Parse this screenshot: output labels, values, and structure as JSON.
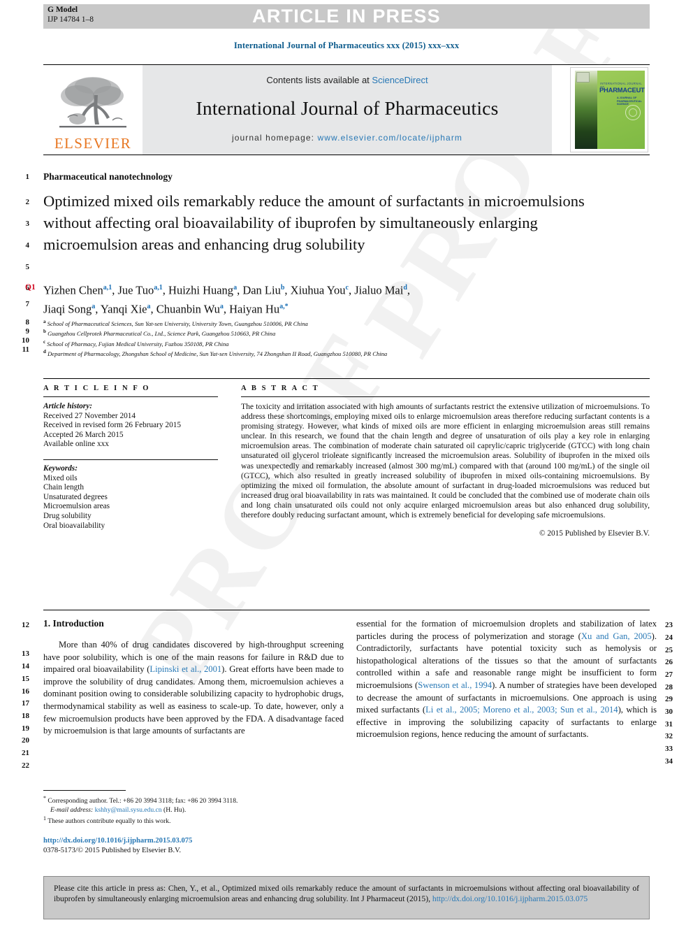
{
  "header": {
    "g_model_line1": "G Model",
    "g_model_line2": "IJP 14784 1–8",
    "article_in_press": "ARTICLE IN PRESS",
    "journal_reference": "International Journal of Pharmaceutics xxx (2015) xxx–xxx"
  },
  "masthead": {
    "contents_prefix": "Contents lists available at ",
    "sciencedirect": "ScienceDirect",
    "journal_title": "International Journal of Pharmaceutics",
    "homepage_prefix": "journal homepage: ",
    "homepage_url": "www.elsevier.com/locate/ijpharm",
    "publisher_wordmark": "ELSEVIER",
    "cover": {
      "supertitle": "INTERNATIONAL JOURNAL OF",
      "title": "PHARMACEUTICS",
      "subtitle": "A JOURNAL OF\nPHARMACEUTICAL\nSCIENCE AND PRACTICE"
    }
  },
  "article": {
    "section_label": "Pharmaceutical nanotechnology",
    "title": "Optimized mixed oils remarkably reduce the amount of surfactants in microemulsions without affecting oral bioavailability of ibuprofen by simultaneously enlarging microemulsion areas and enhancing drug solubility",
    "query_tag": "Q1",
    "authors": [
      {
        "name": "Yizhen Chen",
        "sup": "a,1"
      },
      {
        "name": "Jue Tuo",
        "sup": "a,1"
      },
      {
        "name": "Huizhi Huang",
        "sup": "a"
      },
      {
        "name": "Dan Liu",
        "sup": "b"
      },
      {
        "name": "Xiuhua You",
        "sup": "c"
      },
      {
        "name": "Jialuo Mai",
        "sup": "d"
      },
      {
        "name": "Jiaqi Song",
        "sup": "a"
      },
      {
        "name": "Yanqi Xie",
        "sup": "a"
      },
      {
        "name": "Chuanbin Wu",
        "sup": "a"
      },
      {
        "name": "Haiyan Hu",
        "sup": "a,*"
      }
    ],
    "affiliations": [
      {
        "label": "a",
        "text": "School of Pharmaceutical Sciences, Sun Yat-sen University, University Town, Guangzhou 510006, PR China"
      },
      {
        "label": "b",
        "text": "Guangzhou Cellprotek Pharmaceutical Co., Ltd., Science Park, Guangzhou 510663, PR China"
      },
      {
        "label": "c",
        "text": "School of Pharmacy, Fujian Medical University, Fuzhou 350108, PR China"
      },
      {
        "label": "d",
        "text": "Department of Pharmacology, Zhongshan School of Medicine, Sun Yat-sen University, 74 Zhongshan II Road, Guangzhou 510080, PR China"
      }
    ]
  },
  "article_info": {
    "heading": "A R T I C L E   I N F O",
    "history_label": "Article history:",
    "history": [
      "Received 27 November 2014",
      "Received in revised form 26 February 2015",
      "Accepted 26 March 2015",
      "Available online xxx"
    ],
    "keywords_label": "Keywords:",
    "keywords": [
      "Mixed oils",
      "Chain length",
      "Unsaturated degrees",
      "Microemulsion areas",
      "Drug solubility",
      "Oral bioavailability"
    ]
  },
  "abstract": {
    "heading": "A B S T R A C T",
    "text": "The toxicity and irritation associated with high amounts of surfactants restrict the extensive utilization of microemulsions. To address these shortcomings, employing mixed oils to enlarge microemulsion areas therefore reducing surfactant contents is a promising strategy. However, what kinds of mixed oils are more efficient in enlarging microemulsion areas still remains unclear. In this research, we found that the chain length and degree of unsaturation of oils play a key role in enlarging microemulsion areas. The combination of moderate chain saturated oil caprylic/capric triglyceride (GTCC) with long chain unsaturated oil glycerol trioleate significantly increased the microemulsion areas. Solubility of ibuprofen in the mixed oils was unexpectedly and remarkably increased (almost 300 mg/mL) compared with that (around 100 mg/mL) of the single oil (GTCC), which also resulted in greatly increased solubility of ibuprofen in mixed oils-containing microemulsions. By optimizing the mixed oil formulation, the absolute amount of surfactant in drug-loaded microemulsions was reduced but increased drug oral bioavailability in rats was maintained. It could be concluded that the combined use of moderate chain oils and long chain unsaturated oils could not only acquire enlarged microemulsion areas but also enhanced drug solubility, therefore doubly reducing surfactant amount, which is extremely beneficial for developing safe microemulsions.",
    "copyright": "© 2015 Published by Elsevier B.V."
  },
  "introduction": {
    "heading": "1. Introduction",
    "left_paragraph_part1": "More than 40% of drug candidates discovered by high-throughput screening have poor solubility, which is one of the main reasons for failure in R&D due to impaired oral bioavailability (",
    "left_ref1": "Lipinski et al., 2001",
    "left_paragraph_part2": "). Great efforts have been made to improve the solubility of drug candidates. Among them, microemulsion achieves a dominant position owing to considerable solubilizing capacity to hydrophobic drugs, thermodynamical stability as well as easiness to scale-up. To date, however, only a few microemulsion products have been approved by the FDA. A disadvantage faced by microemulsion is that large amounts of surfactants are",
    "right_part1": "essential for the formation of microemulsion droplets and stabilization of latex particles during the process of polymerization and storage (",
    "right_ref1": "Xu and Gan, 2005",
    "right_part2": "). Contradictorily, surfactants have potential toxicity such as hemolysis or histopathological alterations of the tissues so that the amount of surfactants controlled within a safe and reasonable range might be insufficient to form microemulsions (",
    "right_ref2": "Swenson et al., 1994",
    "right_part3": "). A number of strategies have been developed to decrease the amount of surfactants in microemulsions. One approach is using mixed surfactants (",
    "right_ref3": "Li et al., 2005; Moreno et al., 2003; Sun et al., 2014",
    "right_part4": "), which is effective in improving the solubilizing capacity of surfactants to enlarge microemulsion regions, hence reducing the amount of surfactants."
  },
  "footnotes": {
    "corresponding_marker": "*",
    "corresponding_text": "Corresponding author. Tel.: +86 20 3994 3118; fax: +86 20 3994 3118.",
    "email_label": "E-mail address:",
    "email": "kshhy@mail.sysu.edu.cn",
    "email_suffix": "(H. Hu).",
    "equal_marker": "1",
    "equal_text": "These authors contribute equally to this work."
  },
  "doi_block": {
    "doi_url": "http://dx.doi.org/10.1016/j.ijpharm.2015.03.075",
    "issn_line": "0378-5173/© 2015 Published by Elsevier B.V."
  },
  "cite_box": {
    "text_part1": "Please cite this article in press as: Chen, Y., et al., Optimized mixed oils remarkably reduce the amount of surfactants in microemulsions without affecting oral bioavailability of ibuprofen by simultaneously enlarging microemulsion areas and enhancing drug solubility. Int J Pharmaceut (2015), ",
    "link": "http://dx.doi.org/10.1016/j.ijpharm.2015.03.075"
  },
  "line_numbers": {
    "left_title": [
      "1",
      "2",
      "3",
      "4",
      "5",
      "6",
      "7",
      "8",
      "9",
      "10",
      "11"
    ],
    "left_body": [
      "12",
      "13",
      "14",
      "15",
      "16",
      "17",
      "18",
      "19",
      "20",
      "21",
      "22"
    ],
    "right_body": [
      "23",
      "24",
      "25",
      "26",
      "27",
      "28",
      "29",
      "30",
      "31",
      "32",
      "33",
      "34"
    ]
  },
  "watermark": "PROOF",
  "colors": {
    "link": "#2878b5",
    "journal_ref": "#0d5b8c",
    "elsevier_orange": "#e87722",
    "query_red": "#d0021b",
    "band_gray": "#c8c8c8"
  }
}
